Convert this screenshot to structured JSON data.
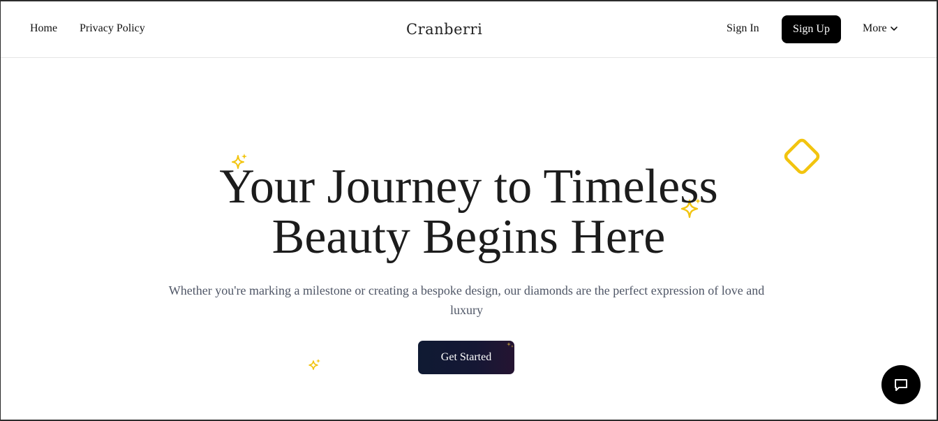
{
  "nav": {
    "home": "Home",
    "privacy": "Privacy Policy",
    "logo": "Cranberri",
    "sign_in": "Sign In",
    "sign_up": "Sign Up",
    "more": "More"
  },
  "hero": {
    "title_line1": "Your Journey to Timeless",
    "title_line2": "Beauty Begins Here",
    "subtitle": "Whether you're marking a milestone or creating a bespoke design, our diamonds are the perfect expression of love and luxury",
    "cta": "Get Started"
  },
  "icons": {
    "sparkle": "sparkle-icon",
    "diamond": "diamond-outline-icon",
    "chat": "chat-icon",
    "chevron": "chevron-down-icon"
  },
  "colors": {
    "accent": "#f2c40f",
    "button_dark": "#000000",
    "cta_start": "#0f1a33",
    "cta_end": "#251432",
    "subtitle": "#4f5666"
  }
}
